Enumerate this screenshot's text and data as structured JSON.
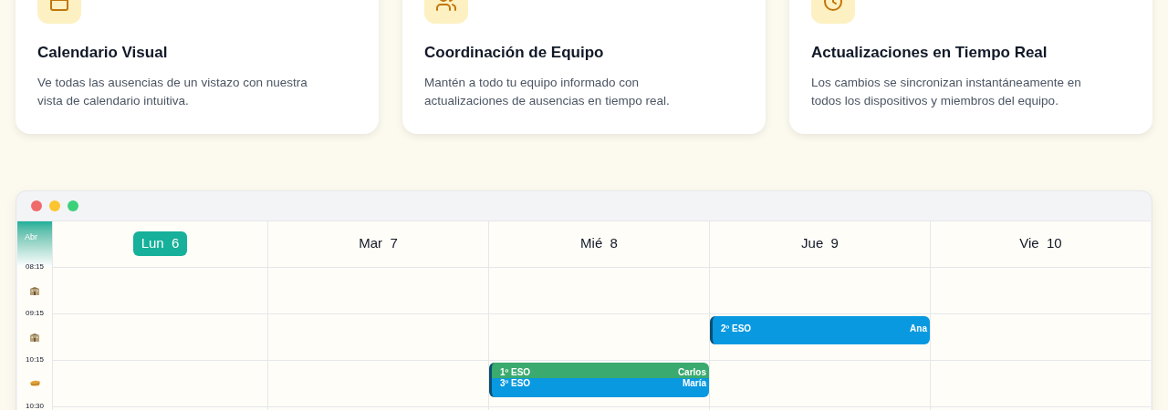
{
  "features": [
    {
      "title": "Calendario Visual",
      "description": "Ve todas las ausencias de un vistazo con nuestra vista de calendario intuitiva."
    },
    {
      "title": "Coordinación de Equipo",
      "description": "Mantén a todo tu equipo informado con actualizaciones de ausencias en tiempo real."
    },
    {
      "title": "Actualizaciones en Tiempo Real",
      "description": "Los cambios se sincronizan instantáneamente en todos los dispositivos y miembros del equipo."
    }
  ],
  "calendar": {
    "month": "Abr",
    "days": [
      {
        "name": "Lun",
        "number": "6",
        "selected": true
      },
      {
        "name": "Mar",
        "number": "7",
        "selected": false
      },
      {
        "name": "Mié",
        "number": "8",
        "selected": false
      },
      {
        "name": "Jue",
        "number": "9",
        "selected": false
      },
      {
        "name": "Vie",
        "number": "10",
        "selected": false
      }
    ],
    "rows": [
      {
        "time": "08:15",
        "kind": "school",
        "cells": [
          {},
          {},
          {},
          {},
          {}
        ]
      },
      {
        "time": "09:15",
        "kind": "school",
        "cells": [
          {},
          {},
          {},
          {
            "events": [
              {
                "group": "2º ESO",
                "person": "Ana",
                "color": "#0899e0"
              }
            ]
          },
          {}
        ]
      },
      {
        "time": "10:15",
        "kind": "bread",
        "cells": [
          {},
          {},
          {
            "events": [
              {
                "group": "1º ESO",
                "person": "Carlos",
                "color": "#3aaa6e"
              },
              {
                "group": "3º ESO",
                "person": "María",
                "color": "#0899e0"
              }
            ]
          },
          {},
          {}
        ]
      },
      {
        "time": "10:30",
        "kind": "plain",
        "cells": [
          {},
          {},
          {},
          {},
          {}
        ]
      }
    ]
  }
}
